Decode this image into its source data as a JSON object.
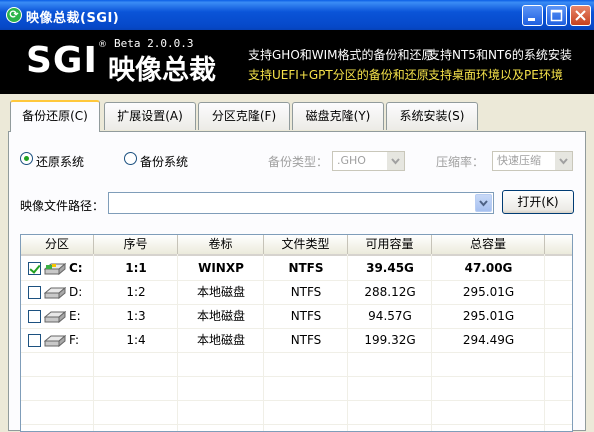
{
  "window": {
    "title": "映像总裁(SGI)"
  },
  "banner": {
    "logo": "SGI",
    "registered": "®",
    "version": "Beta 2.0.0.3",
    "logo_cn": "映像总裁",
    "line1a": "支持GHO和WIM格式的备份和还原",
    "line1b": "支持NT5和NT6的系统安装",
    "line2a": "支持UEFI+GPT分区的备份和还原",
    "line2b": "支持桌面环境以及PE环境"
  },
  "tabs": [
    {
      "label": "备份还原(C)",
      "active": true
    },
    {
      "label": "扩展设置(A)",
      "active": false
    },
    {
      "label": "分区克隆(F)",
      "active": false
    },
    {
      "label": "磁盘克隆(Y)",
      "active": false
    },
    {
      "label": "系统安装(S)",
      "active": false
    }
  ],
  "options": {
    "restore_label": "还原系统",
    "backup_label": "备份系统",
    "backup_type_label": "备份类型：",
    "backup_type_value": ".GHO",
    "compress_label": "压缩率：",
    "compress_value": "快速压缩"
  },
  "path": {
    "label": "映像文件路径：",
    "value": "",
    "open_button": "打开(K)"
  },
  "table": {
    "columns": [
      "分区",
      "序号",
      "卷标",
      "文件类型",
      "可用容量",
      "总容量"
    ],
    "rows": [
      {
        "checked": true,
        "drive": "C:",
        "index": "1:1",
        "label": "WINXP",
        "fs": "NTFS",
        "free": "39.45G",
        "total": "47.00G",
        "bold": true
      },
      {
        "checked": false,
        "drive": "D:",
        "index": "1:2",
        "label": "本地磁盘",
        "fs": "NTFS",
        "free": "288.12G",
        "total": "295.01G",
        "bold": false
      },
      {
        "checked": false,
        "drive": "E:",
        "index": "1:3",
        "label": "本地磁盘",
        "fs": "NTFS",
        "free": "94.57G",
        "total": "295.01G",
        "bold": false
      },
      {
        "checked": false,
        "drive": "F:",
        "index": "1:4",
        "label": "本地磁盘",
        "fs": "NTFS",
        "free": "199.32G",
        "total": "294.49G",
        "bold": false
      }
    ]
  }
}
